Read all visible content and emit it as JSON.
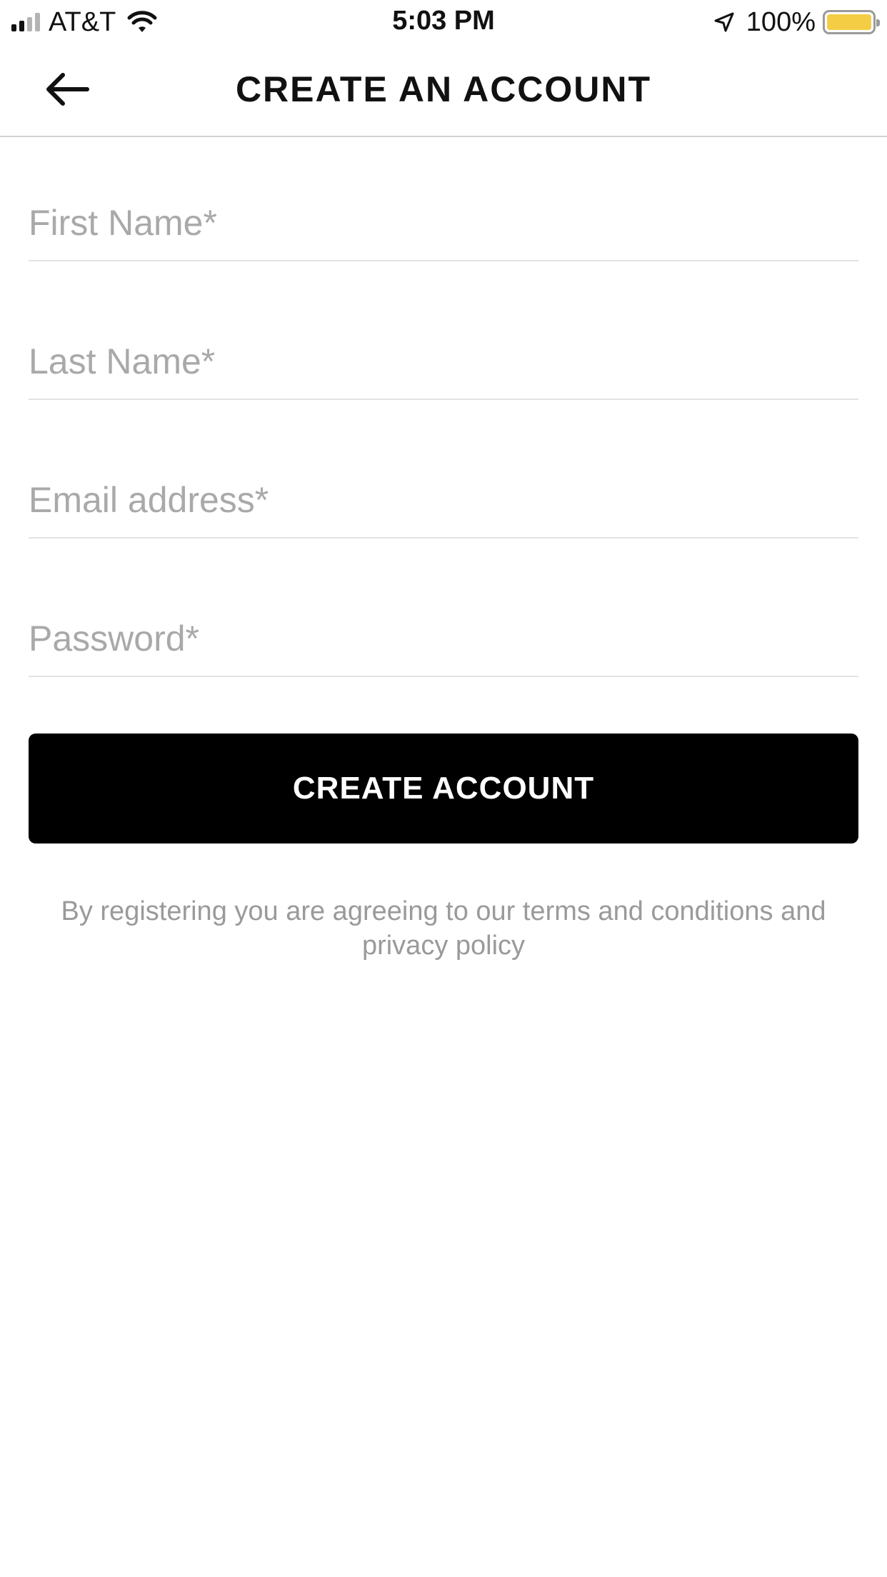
{
  "status_bar": {
    "carrier": "AT&T",
    "time": "5:03 PM",
    "battery_percent": "100%",
    "battery_color": "#f5cd45",
    "icons": [
      "signal-icon",
      "wifi-icon",
      "location-arrow-icon",
      "battery-icon"
    ]
  },
  "nav": {
    "back_icon": "arrow-left-icon",
    "title": "CREATE AN ACCOUNT"
  },
  "form": {
    "first_name_placeholder": "First Name*",
    "last_name_placeholder": "Last Name*",
    "email_placeholder": "Email address*",
    "password_placeholder": "Password*"
  },
  "actions": {
    "create_account_label": "CREATE ACCOUNT"
  },
  "terms": {
    "prefix": "By registering you are agreeing to our ",
    "terms_link": "terms and conditions",
    "middle": " and ",
    "privacy_link": "privacy policy"
  },
  "colors": {
    "button_background": "#000000",
    "button_text": "#ffffff",
    "placeholder": "#a9a9a9",
    "divider": "#e3e3e3"
  }
}
